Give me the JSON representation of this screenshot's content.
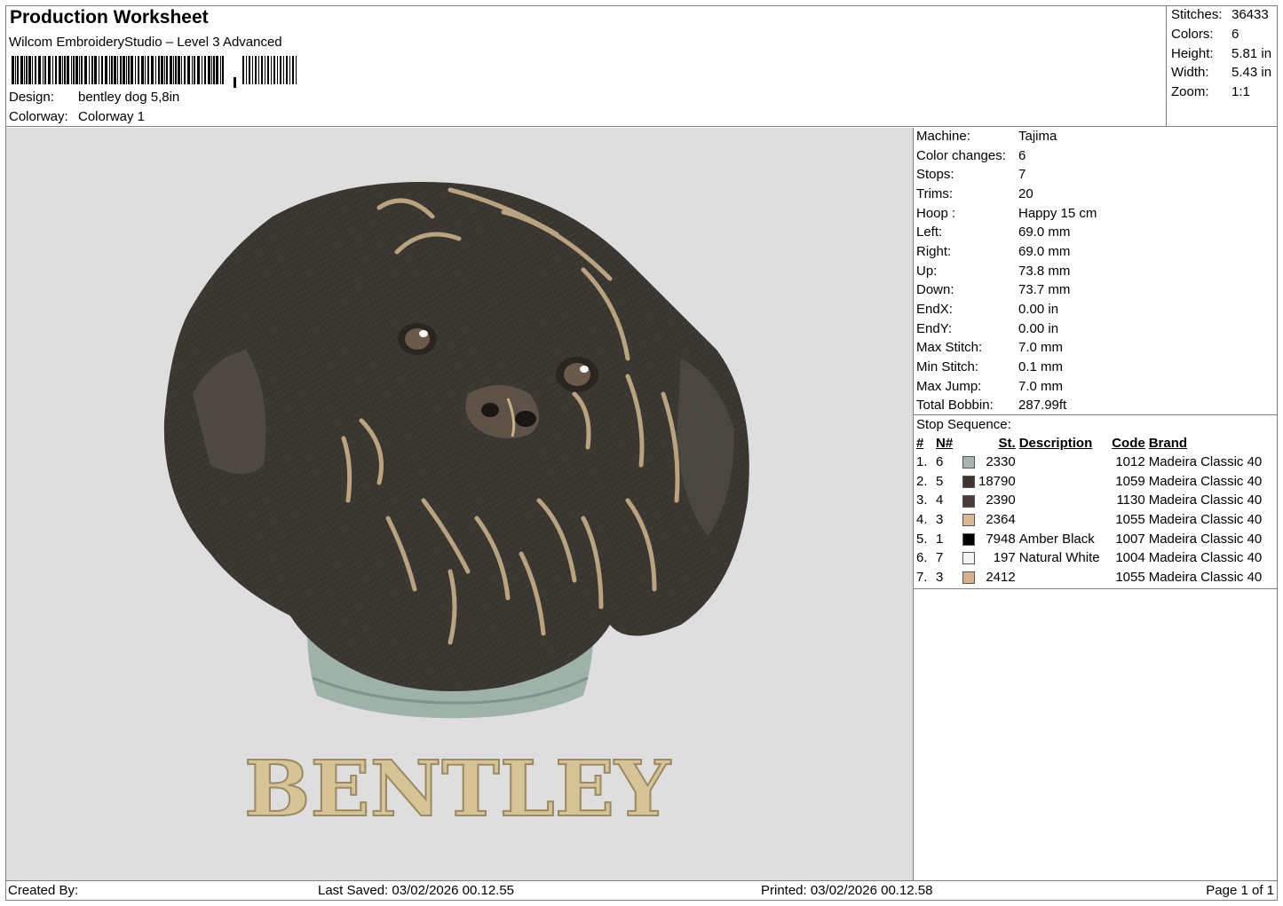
{
  "header": {
    "title": "Production Worksheet",
    "software": "Wilcom EmbroideryStudio – Level 3 Advanced",
    "design_label": "Design:",
    "design_value": "bentley dog 5,8in",
    "colorway_label": "Colorway:",
    "colorway_value": "Colorway 1"
  },
  "stats": [
    {
      "label": "Stitches:",
      "value": "36433"
    },
    {
      "label": "Colors:",
      "value": "6"
    },
    {
      "label": "Height:",
      "value": "5.81 in"
    },
    {
      "label": "Width:",
      "value": "5.43 in"
    },
    {
      "label": "Zoom:",
      "value": "1:1"
    }
  ],
  "preview": {
    "text": "BENTLEY",
    "colors": {
      "background": "#dedede",
      "fur_dark": "#3b3732",
      "fur_tan": "#c8b088",
      "collar": "#9fb2aa",
      "text": "#d6c396"
    }
  },
  "machine_info": [
    {
      "label": "Machine:",
      "value": "Tajima"
    },
    {
      "label": "Color changes:",
      "value": "6"
    },
    {
      "label": "Stops:",
      "value": "7"
    },
    {
      "label": "Trims:",
      "value": "20"
    },
    {
      "label": "Hoop :",
      "value": "Happy 15 cm"
    },
    {
      "label": "Left:",
      "value": "69.0 mm"
    },
    {
      "label": "Right:",
      "value": "69.0 mm"
    },
    {
      "label": "Up:",
      "value": "73.8 mm"
    },
    {
      "label": "Down:",
      "value": "73.7 mm"
    },
    {
      "label": "EndX:",
      "value": "0.00 in"
    },
    {
      "label": "EndY:",
      "value": "0.00 in"
    },
    {
      "label": "Max Stitch:",
      "value": "7.0 mm"
    },
    {
      "label": "Min Stitch:",
      "value": "0.1 mm"
    },
    {
      "label": "Max Jump:",
      "value": "7.0 mm"
    },
    {
      "label": "Total Bobbin:",
      "value": "287.99ft"
    }
  ],
  "stop_sequence": {
    "title": "Stop Sequence:",
    "headers": {
      "num": "#",
      "n": "N#",
      "st": "St.",
      "description": "Description",
      "code": "Code",
      "brand": "Brand"
    },
    "rows": [
      {
        "num": "1.",
        "n": "6",
        "color": "#a8b4b0",
        "st": "2330",
        "description": "",
        "code": "1012",
        "brand": "Madeira Classic 40"
      },
      {
        "num": "2.",
        "n": "5",
        "color": "#3e3530",
        "st": "18790",
        "description": "",
        "code": "1059",
        "brand": "Madeira Classic 40"
      },
      {
        "num": "3.",
        "n": "4",
        "color": "#4a3c3a",
        "st": "2390",
        "description": "",
        "code": "1130",
        "brand": "Madeira Classic 40"
      },
      {
        "num": "4.",
        "n": "3",
        "color": "#d9b894",
        "st": "2364",
        "description": "",
        "code": "1055",
        "brand": "Madeira Classic 40"
      },
      {
        "num": "5.",
        "n": "1",
        "color": "#000000",
        "st": "7948",
        "description": "Amber Black",
        "code": "1007",
        "brand": "Madeira Classic 40"
      },
      {
        "num": "6.",
        "n": "7",
        "color": "#f4f4f4",
        "st": "197",
        "description": "Natural White",
        "code": "1004",
        "brand": "Madeira Classic 40"
      },
      {
        "num": "7.",
        "n": "3",
        "color": "#d9b08c",
        "st": "2412",
        "description": "",
        "code": "1055",
        "brand": "Madeira Classic 40"
      }
    ]
  },
  "footer": {
    "created_by": "Created By:",
    "last_saved": "Last Saved: 03/02/2026 00.12.55",
    "printed": "Printed: 03/02/2026 00.12.58",
    "page": "Page 1 of 1"
  }
}
